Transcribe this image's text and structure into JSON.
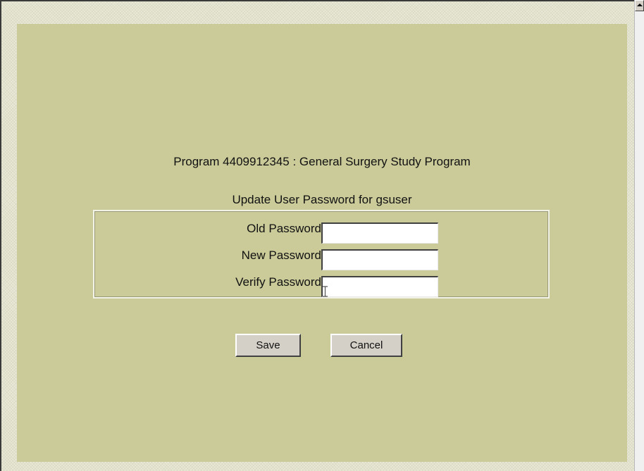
{
  "program": {
    "title": "Program 4409912345 : General Surgery Study Program"
  },
  "form": {
    "subtitle": "Update User Password for gsuser",
    "fields": [
      {
        "label": "Old Password",
        "value": ""
      },
      {
        "label": "New Password",
        "value": ""
      },
      {
        "label": "Verify Password",
        "value": ""
      }
    ]
  },
  "buttons": {
    "save_label": "Save",
    "cancel_label": "Cancel"
  },
  "colors": {
    "panel_bg": "#cbcb9a",
    "frame_bg": "#e9e9d9",
    "button_face": "#d4d0c8"
  }
}
